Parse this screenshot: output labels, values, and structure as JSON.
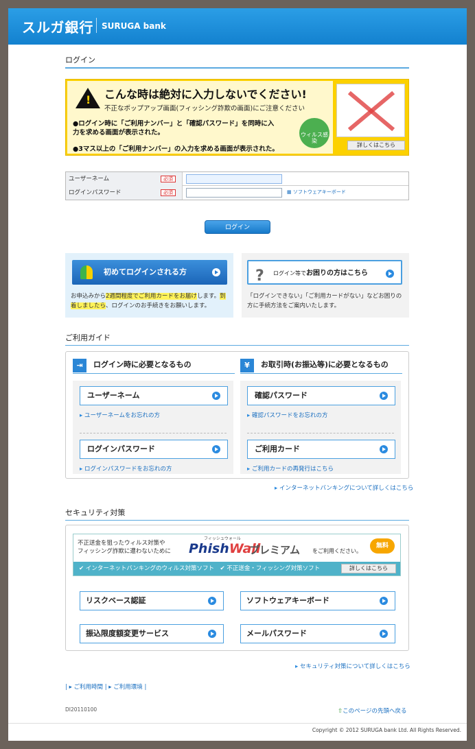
{
  "header": {
    "logo_ja": "スルガ銀行",
    "logo_en": "SURUGA bank",
    "brand_color": "#1a8ad8"
  },
  "login_section": {
    "title": "ログイン"
  },
  "warning": {
    "headline": "こんな時は絶対に入力しないでください!",
    "subline": "不正なポップアップ画面(フィッシング詐欺の画面)にご注意ください",
    "item1": "●ログイン時に「ご利用ナンバー」と「確認パスワード」を同時に入力を求める画面が表示された。",
    "item2": "●3マス以上の「ご利用ナンバー」の入力を求める画面が表示された。",
    "virus_badge": "ウィルス感染",
    "detail_button": "詳しくはこちら"
  },
  "form": {
    "username_label": "ユーザーネーム",
    "password_label": "ログインパスワード",
    "required": "必須",
    "software_keyboard": "ソフトウェアキーボード",
    "login_button": "ログイン"
  },
  "first_login": {
    "button": "初めてログインされる方",
    "text_a": "お申込みから",
    "text_hl1": "2週間程度でご利用カードをお届け",
    "text_b": "します。",
    "text_hl2": "到着しましたら",
    "text_c": "、ログインのお手続きをお願いします。"
  },
  "help": {
    "button_small": "ログイン等で",
    "button_big": "お困りの方はこちら",
    "text": "「ログインできない」「ご利用カードがない」などお困りの方に手続方法をご案内いたします。"
  },
  "guide": {
    "title": "ご利用ガイド",
    "left_head": "ログイン時に必要となるもの",
    "right_head": "お取引時(お振込等)に必要となるもの",
    "left_items": [
      {
        "label": "ユーザーネーム",
        "link": "ユーザーネームをお忘れの方"
      },
      {
        "label": "ログインパスワード",
        "link": "ログインパスワードをお忘れの方"
      }
    ],
    "right_items": [
      {
        "label": "確認パスワード",
        "link": "確認パスワードをお忘れの方"
      },
      {
        "label": "ご利用カード",
        "link": "ご利用カードの再発行はこちら"
      }
    ],
    "more_link": "インターネットバンキングについて詳しくはこちら"
  },
  "security": {
    "title": "セキュリティ対策",
    "phish_text1": "不正送金を狙ったウィルス対策や",
    "phish_text2": "フィッシング詐欺に遭わないために",
    "phish_ruby": "フィッシュウォール",
    "phish_logo_a": "Phish",
    "phish_logo_b": "Wall",
    "phish_premium": "プレミアム",
    "phish_use": "をご利用ください。",
    "phish_free": "無料",
    "phish_bar": "✔ インターネットバンキングのウィルス対策ソフト　✔ 不正送金・フィッシング対策ソフト",
    "phish_detail": "詳しくはこちら",
    "buttons": [
      "リスクベース認証",
      "ソフトウェアキーボード",
      "振込限度額変更サービス",
      "メールパスワード"
    ],
    "more_link": "セキュリティ対策について詳しくはこちら"
  },
  "footer": {
    "links": "| ▸ ご利用時間 | ▸ ご利用環境 |",
    "code": "DI20110100",
    "top_link": "このページの先頭へ戻る",
    "copyright": "Copyright © 2012 SURUGA bank Ltd. All Rights Reserved."
  }
}
